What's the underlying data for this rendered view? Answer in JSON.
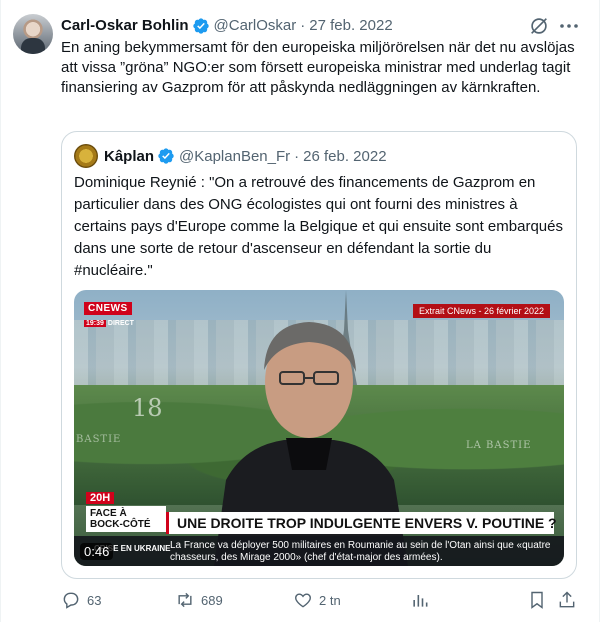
{
  "tweet": {
    "author_name": "Carl-Oskar Bohlin",
    "handle": "@CarlOskar",
    "separator": "·",
    "date": "27 feb. 2022",
    "text": "En aning bekymmersamt för den europeiska miljörörelsen när det nu avslöjas att vissa ”gröna” NGO:er som försett europeiska ministrar med underlag tagit finansiering av Gazprom för att påskynda nedläggningen av kärnkraften."
  },
  "quote": {
    "author_name": "Kâplan",
    "handle": "@KaplanBen_Fr",
    "separator": "·",
    "date": "26 feb. 2022",
    "text": "Dominique Reynié : \"On a retrouvé des financements de Gazprom en particulier dans des ONG écologistes qui ont fourni des ministres à certains pays d'Europe comme la Belgique et qui ensuite sont embarqués dans une sorte de retour d'ascenseur en défendant la sortie du #nucléaire.\""
  },
  "video": {
    "channel_logo": "CNEWS",
    "clock_time": "19:39",
    "clock_label": "DIRECT",
    "extrait": "Extrait CNews - 26 février 2022",
    "bg_number": "18",
    "bg_text_right": "LA BASTIE",
    "bg_text_left": "BASTIE",
    "show_time": "20H",
    "show_name": "FACE À BOCK-CÔTÉ",
    "headline": "UNE DROITE TROP INDULGENTE ENVERS V. POUTINE ?",
    "ticker_label": "CRISE EN UKRAINE",
    "ticker_text": "La France va déployer 500 militaires en Roumanie au sein de l'Otan ainsi que «quatre chasseurs, des Mirage 2000» (chef d'état-major des armées).",
    "duration": "0:46"
  },
  "actions": {
    "replies": "63",
    "retweets": "689",
    "likes": "2 tn"
  },
  "colors": {
    "verified": "#1d9bf0",
    "muted": "#536471",
    "border": "#cfd9de"
  }
}
